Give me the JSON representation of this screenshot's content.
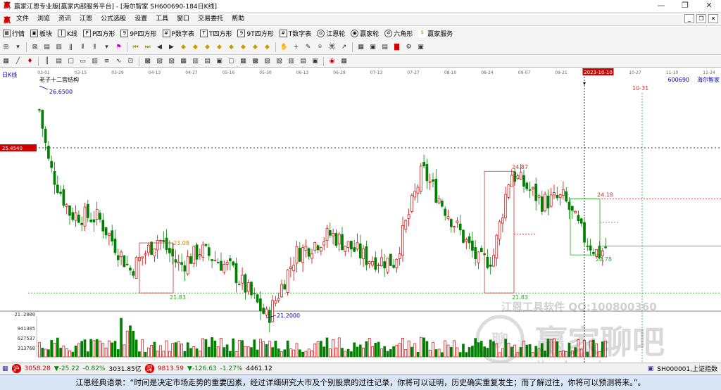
{
  "titlebar": {
    "title": "赢家江恩专业版[赢家内部服务平台] - [海尔智家  SH600690-184日K线]",
    "logo": "赢"
  },
  "menubar": {
    "logo": "赢",
    "items": [
      "文件",
      "浏览",
      "资讯",
      "江恩",
      "公式选股",
      "设置",
      "工具",
      "窗口",
      "交易委托",
      "帮助"
    ]
  },
  "toolbar1": {
    "items": [
      {
        "icon": "grid-icon",
        "label": "行情"
      },
      {
        "icon": "block-icon",
        "label": "板块"
      },
      {
        "icon": "kline-icon",
        "label": "K线"
      },
      {
        "icon": "p-icon",
        "label": "P四方形"
      },
      {
        "icon": "9p-icon",
        "label": "9P四方形"
      },
      {
        "icon": "pn-icon",
        "label": "P数字表"
      },
      {
        "icon": "t-icon",
        "label": "T四方形"
      },
      {
        "icon": "9t-icon",
        "label": "9T四方形"
      },
      {
        "icon": "tn-icon",
        "label": "T数字表"
      },
      {
        "icon": "wheel-icon",
        "label": "江恩轮"
      },
      {
        "icon": "wheel2-icon",
        "label": "赢家轮"
      },
      {
        "icon": "hexagon-icon",
        "label": "六角形"
      },
      {
        "icon": "dollar-icon",
        "label": "赢家服务"
      }
    ]
  },
  "datebar": {
    "dates": [
      "03-01",
      "03-15",
      "03-29",
      "04-13",
      "04-27",
      "05-16",
      "05-30",
      "06-13",
      "06-29",
      "07-13",
      "07-27",
      "08-10",
      "08-24",
      "09-07",
      "09-21",
      "2023-10-10",
      "10-27",
      "11-10",
      "11-24"
    ],
    "highlight": "2023-10-10"
  },
  "chart": {
    "period_label": "日K线",
    "stock_code": "600690",
    "stock_name": "海尔智家",
    "indicator_name": "老子十二宫结构",
    "price_marker": "25.4540",
    "future_date": "10-31",
    "labels": {
      "high": "26.6500",
      "low": "21.2000",
      "l_2483": "24.87",
      "l_2418": "24.18",
      "l_2308": "23.08",
      "l_2183a": "21.83",
      "l_2183b": "21.83",
      "l_2278": "22.78"
    },
    "vol_axis": [
      "21.2000",
      "941305",
      "627537",
      "313768"
    ],
    "watermark_top": "江恩工具软件  QQ:100800360",
    "watermark_main": "赢家聊吧",
    "watermark_sub": "jiaoba.vip"
  },
  "statusbar": {
    "sh_index": "3058.28",
    "sh_change": "▼-25.22",
    "sh_pct": "-0.82%",
    "sh_amount": "3031.85亿",
    "sz_index": "9813.59",
    "sz_change": "▼-126.63",
    "sz_pct": "-1.27%",
    "sz_amount": "4461.12",
    "right_code": "SH000001,上证指数"
  },
  "quote": "江恩经典语录：“时间是决定市场走势的重要因素，经过详细研究大市及个别股票的过往记录，你将可以证明，历史确实重复发生；而了解过往，你将可以预测将来。”。",
  "colors": {
    "up": "#d00000",
    "down": "#008000",
    "marker_bg": "#d00000"
  }
}
